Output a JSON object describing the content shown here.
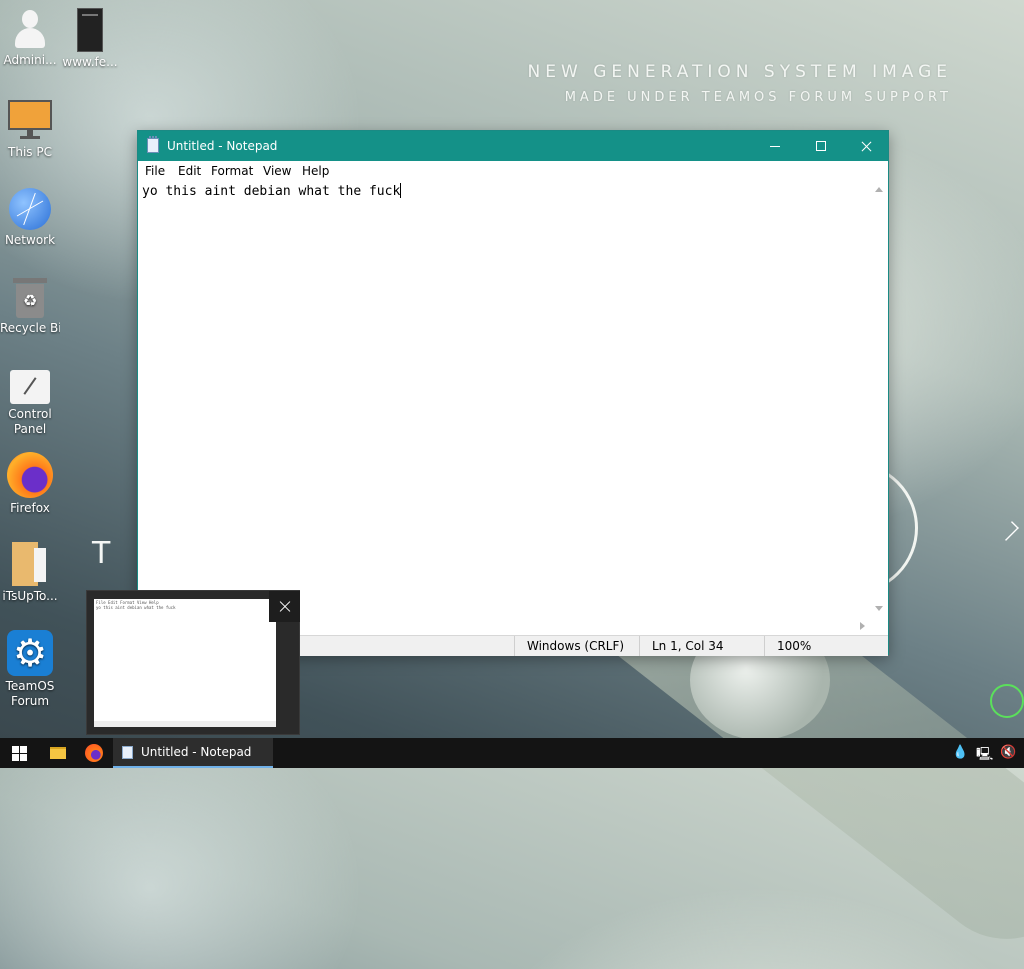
{
  "wallpaper": {
    "line1": "NEW GENERATION SYSTEM IMAGE",
    "line2": "MADE UNDER TEAMOS FORUM SUPPORT",
    "partial": "T O"
  },
  "desktop_icons": [
    {
      "label": "Admini...",
      "icon": "user-icon"
    },
    {
      "label": "www.fe...",
      "icon": "document-icon"
    },
    {
      "label": "This PC",
      "icon": "monitor-icon"
    },
    {
      "label": "Network",
      "icon": "network-globe-icon"
    },
    {
      "label": "Recycle Bin",
      "icon": "recycle-bin-icon"
    },
    {
      "label": "Control Panel",
      "icon": "control-panel-icon"
    },
    {
      "label": "Firefox",
      "icon": "firefox-icon"
    },
    {
      "label": "iTsUpTo...",
      "icon": "folder-icon"
    },
    {
      "label": "TeamOS Forum",
      "icon": "gear-icon"
    }
  ],
  "notepad": {
    "title": "Untitled - Notepad",
    "menu": [
      "File",
      "Edit",
      "Format",
      "View",
      "Help"
    ],
    "content": "yo this aint debian what the fuck",
    "status": {
      "line_ending": "Windows (CRLF)",
      "position": "Ln 1, Col 34",
      "zoom": "100%"
    }
  },
  "preview": {
    "thumb_menu": "File Edit Format View Help",
    "thumb_text": "yo this aint debian what the fuck"
  },
  "taskbar": {
    "active_window": "Untitled - Notepad"
  },
  "colors": {
    "title_bar": "#149188",
    "taskbar": "#141414"
  }
}
